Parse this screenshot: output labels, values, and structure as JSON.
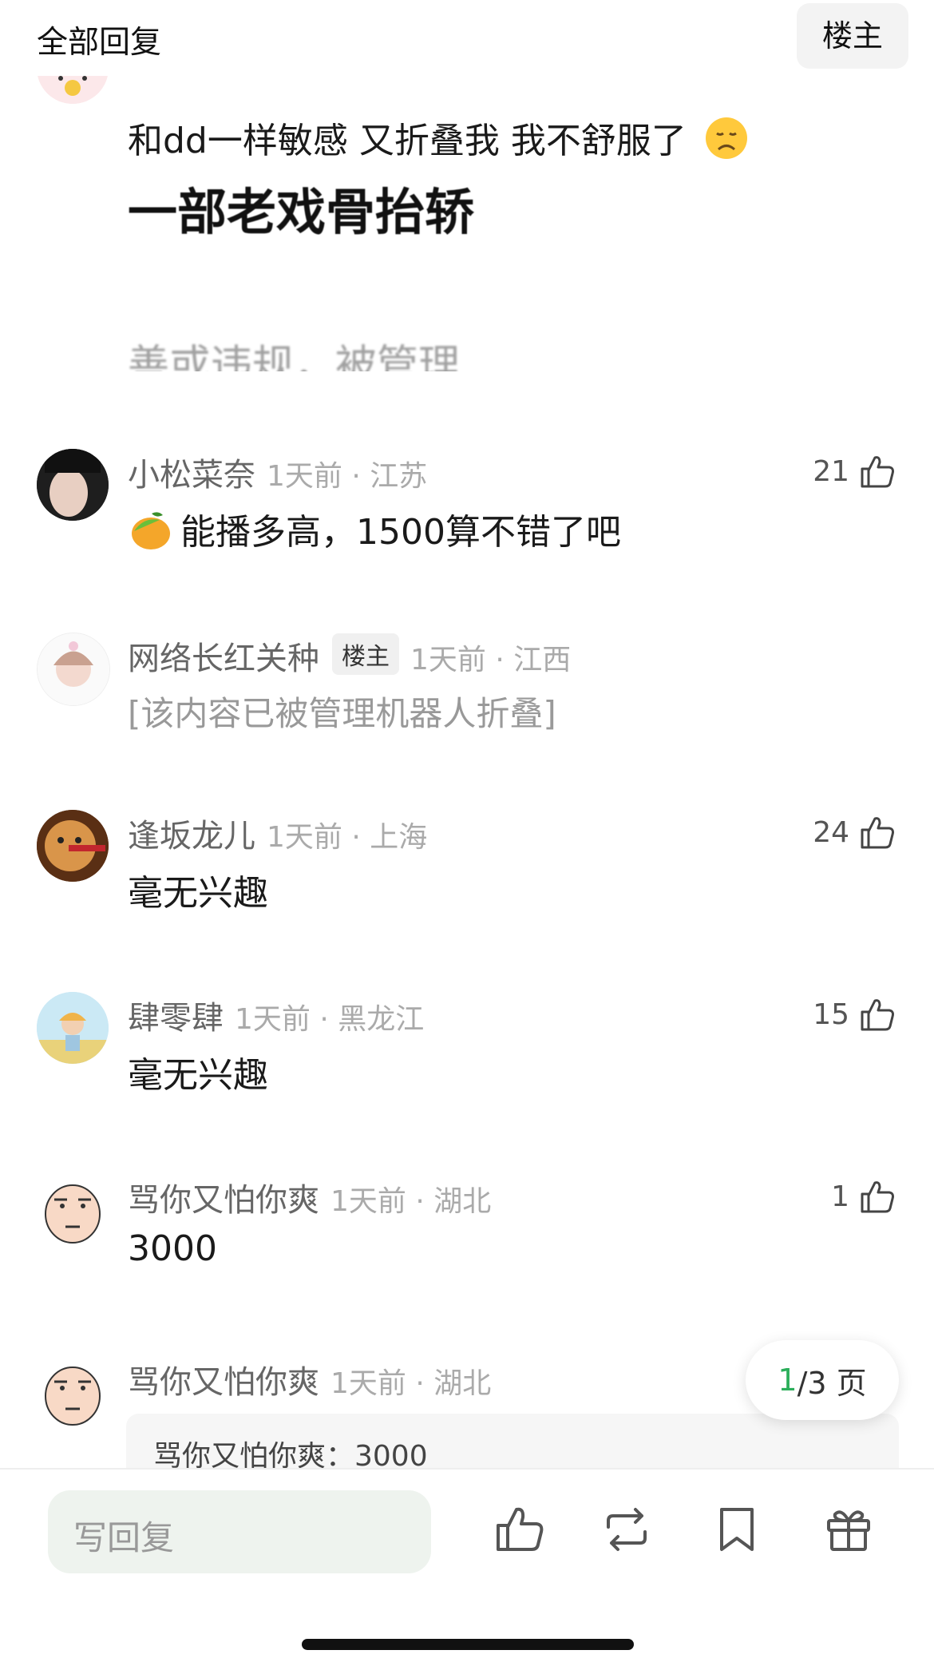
{
  "header": {
    "title": "全部回复",
    "op_button": "楼主"
  },
  "top_comment": {
    "text": "和dd一样敏感 又折叠我 我不舒服了",
    "image_line1": "一部老戏骨抬轿",
    "image_line2": "善或违规，被管理"
  },
  "comments": [
    {
      "name": "小松菜奈",
      "time": "1天前 · 江苏",
      "content": "能播多高，1500算不错了吧",
      "likes": "21"
    },
    {
      "name": "网络长红关种",
      "tag": "楼主",
      "time": "1天前 · 江西",
      "content": "[该内容已被管理机器人折叠]"
    },
    {
      "name": "逢坂龙儿",
      "time": "1天前 · 上海",
      "content": "毫无兴趣",
      "likes": "24"
    },
    {
      "name": "肆零肆",
      "time": "1天前 · 黑龙江",
      "content": "毫无兴趣",
      "likes": "15"
    },
    {
      "name": "骂你又怕你爽",
      "time": "1天前 · 湖北",
      "content": "3000",
      "likes": "1"
    },
    {
      "name": "骂你又怕你爽",
      "time": "1天前 · 湖北",
      "quote": "骂你又怕你爽：3000"
    }
  ],
  "pager": {
    "current": "1",
    "total_suffix": "/3 页"
  },
  "bottom_bar": {
    "reply_placeholder": "写回复"
  },
  "colors": {
    "accent_green": "#2bae5a",
    "input_bg": "#eef3ee"
  }
}
